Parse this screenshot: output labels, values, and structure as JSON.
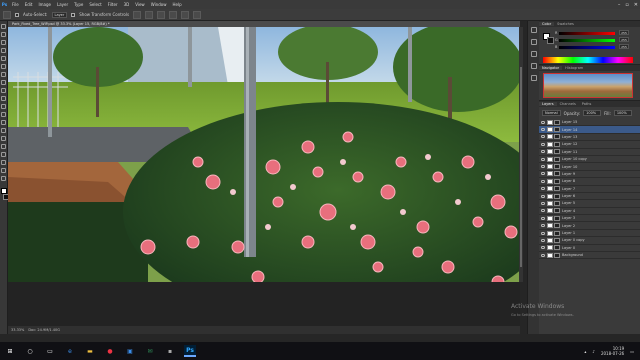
{
  "menubar": {
    "logo": "Ps",
    "items": [
      "File",
      "Edit",
      "Image",
      "Layer",
      "Type",
      "Select",
      "Filter",
      "3D",
      "View",
      "Window",
      "Help"
    ]
  },
  "options": {
    "auto_select_label": "Auto-Select:",
    "auto_select_value": "Layer",
    "transform_label": "Show Transform Controls"
  },
  "document": {
    "tab_title": "Park_Fixed_Tree_WIP.psd @ 33.3% (Layer 15, RGB/8#) *"
  },
  "status": {
    "zoom": "33.33%",
    "doc": "Doc: 24.9M/1.40G"
  },
  "panels": {
    "color_tabs": [
      "Color",
      "Swatches"
    ],
    "sliders": [
      {
        "label": "R",
        "value": "255"
      },
      {
        "label": "G",
        "value": "255"
      },
      {
        "label": "B",
        "value": "255"
      }
    ],
    "navigator_tabs": [
      "Navigator",
      "Histogram"
    ],
    "layers_tabs": [
      "Layers",
      "Channels",
      "Paths"
    ],
    "blend_mode": "Normal",
    "opacity_label": "Opacity:",
    "opacity": "100%",
    "fill_label": "Fill:",
    "fill": "100%",
    "layers": [
      "Layer 15",
      "Layer 14",
      "Layer 13",
      "Layer 12",
      "Layer 11",
      "Layer 10 copy",
      "Layer 10",
      "Layer 9",
      "Layer 8",
      "Layer 7",
      "Layer 6",
      "Layer 5",
      "Layer 4",
      "Layer 3",
      "Layer 2",
      "Layer 1",
      "Layer 0 copy",
      "Layer 0",
      "Background"
    ],
    "selected_layer_index": 1
  },
  "watermark": {
    "line1": "Activate Windows",
    "line2": "Go to Settings to activate Windows."
  },
  "taskbar": {
    "start_icon": "windows-icon",
    "apps": [
      "search-icon",
      "taskview-icon",
      "edge-icon",
      "explorer-icon",
      "chrome-icon",
      "store-icon",
      "mail-icon",
      "terminal-icon",
      "photoshop-icon"
    ],
    "time": "10:19",
    "date": "2018-07-26"
  }
}
